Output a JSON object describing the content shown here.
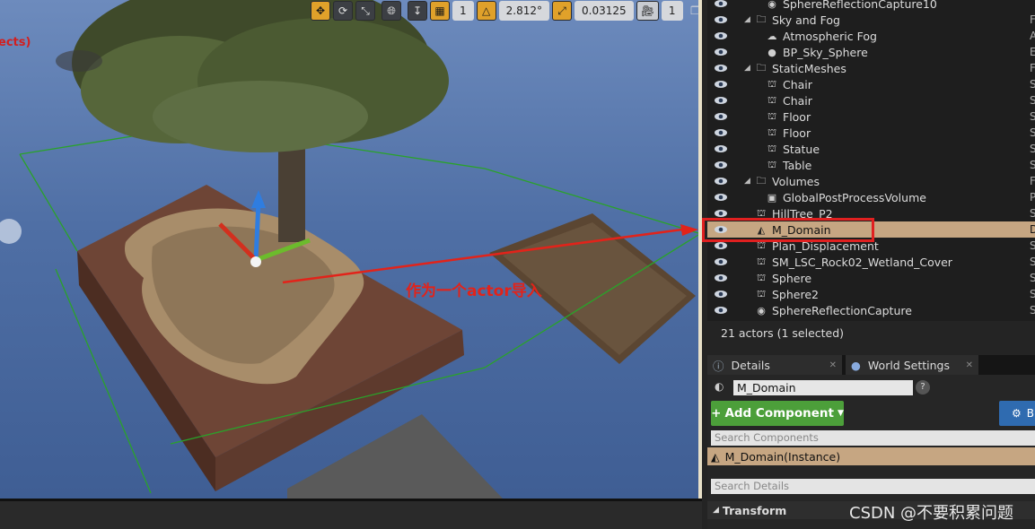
{
  "viewport": {
    "left_partial_text": "ects)",
    "annotation": "作为一个actor导入",
    "toolbar": {
      "grid_value": "1",
      "angle_value": "2.812°",
      "scale_value": "0.03125",
      "camera_speed": "1"
    }
  },
  "outliner": {
    "rows": [
      {
        "label": "SphereReflectionCapture10",
        "type": "",
        "icon": "reflection-capture-icon",
        "indent": 2,
        "expander": false
      },
      {
        "label": "Sky and Fog",
        "type": "F",
        "icon": "folder-icon",
        "indent": 1,
        "expander": true
      },
      {
        "label": "Atmospheric Fog",
        "type": "A",
        "icon": "atmospheric-fog-icon",
        "indent": 2,
        "expander": false
      },
      {
        "label": "BP_Sky_Sphere",
        "type": "E",
        "icon": "sphere-icon",
        "indent": 2,
        "expander": false
      },
      {
        "label": "StaticMeshes",
        "type": "F",
        "icon": "folder-icon",
        "indent": 1,
        "expander": true
      },
      {
        "label": "Chair",
        "type": "S",
        "icon": "static-mesh-icon",
        "indent": 2,
        "expander": false
      },
      {
        "label": "Chair",
        "type": "S",
        "icon": "static-mesh-icon",
        "indent": 2,
        "expander": false
      },
      {
        "label": "Floor",
        "type": "S",
        "icon": "static-mesh-icon",
        "indent": 2,
        "expander": false
      },
      {
        "label": "Floor",
        "type": "S",
        "icon": "static-mesh-icon",
        "indent": 2,
        "expander": false
      },
      {
        "label": "Statue",
        "type": "S",
        "icon": "static-mesh-icon",
        "indent": 2,
        "expander": false
      },
      {
        "label": "Table",
        "type": "S",
        "icon": "static-mesh-icon",
        "indent": 2,
        "expander": false
      },
      {
        "label": "Volumes",
        "type": "F",
        "icon": "folder-icon",
        "indent": 1,
        "expander": true
      },
      {
        "label": "GlobalPostProcessVolume",
        "type": "P",
        "icon": "post-process-volume-icon",
        "indent": 2,
        "expander": false
      },
      {
        "label": "HillTree_P2",
        "type": "S",
        "icon": "static-mesh-icon",
        "indent": 1,
        "expander": false
      },
      {
        "label": "M_Domain",
        "type": "D",
        "icon": "landscape-icon",
        "indent": 1,
        "expander": false,
        "selected": true
      },
      {
        "label": "Plan_Displacement",
        "type": "S",
        "icon": "static-mesh-icon",
        "indent": 1,
        "expander": false
      },
      {
        "label": "SM_LSC_Rock02_Wetland_Cover",
        "type": "S",
        "icon": "static-mesh-icon",
        "indent": 1,
        "expander": false
      },
      {
        "label": "Sphere",
        "type": "S",
        "icon": "static-mesh-icon",
        "indent": 1,
        "expander": false
      },
      {
        "label": "Sphere2",
        "type": "S",
        "icon": "static-mesh-icon",
        "indent": 1,
        "expander": false
      },
      {
        "label": "SphereReflectionCapture",
        "type": "S",
        "icon": "reflection-capture-icon",
        "indent": 1,
        "expander": false
      }
    ],
    "actor_count": "21 actors (1 selected)"
  },
  "tabs": {
    "details": "Details",
    "world_settings": "World Settings"
  },
  "details": {
    "name_value": "M_Domain",
    "add_component": "Add Component",
    "blueprint_button": "B",
    "search_components_placeholder": "Search Components",
    "component_instance": "M_Domain(Instance)",
    "search_details_placeholder": "Search Details",
    "transform_header": "Transform"
  },
  "watermark": "CSDN @不要积累问题"
}
